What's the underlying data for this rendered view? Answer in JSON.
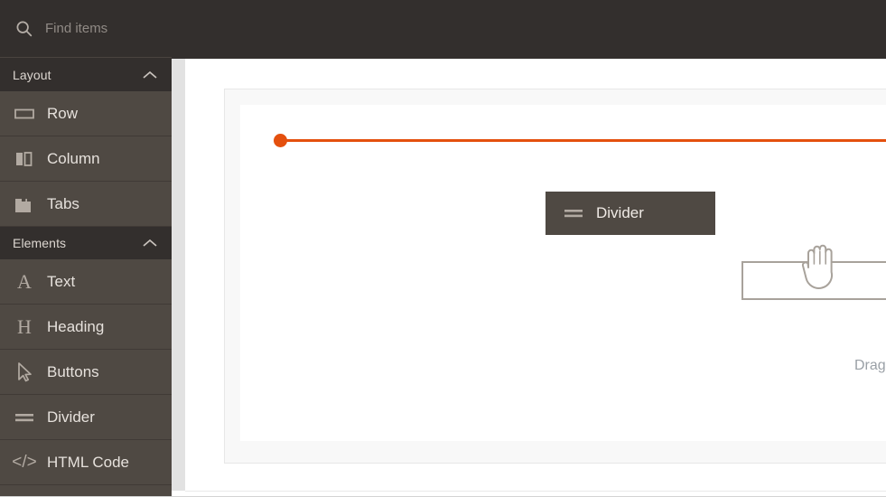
{
  "search": {
    "placeholder": "Find items",
    "value": "",
    "icon": "search-icon"
  },
  "sidebar": {
    "sections": [
      {
        "title": "Layout",
        "collapse_icon": "chevron-up-icon",
        "items": [
          {
            "label": "Row",
            "icon": "row-icon"
          },
          {
            "label": "Column",
            "icon": "column-icon"
          },
          {
            "label": "Tabs",
            "icon": "tabs-icon"
          }
        ]
      },
      {
        "title": "Elements",
        "collapse_icon": "chevron-up-icon",
        "items": [
          {
            "label": "Text",
            "icon": "text-a-icon"
          },
          {
            "label": "Heading",
            "icon": "heading-h-icon"
          },
          {
            "label": "Buttons",
            "icon": "cursor-arrow-icon"
          },
          {
            "label": "Divider",
            "icon": "divider-icon"
          },
          {
            "label": "HTML Code",
            "icon": "code-icon"
          }
        ]
      }
    ]
  },
  "canvas": {
    "drop_indicator_color": "#e4500e",
    "drag_caption": "Drag con",
    "cursor_icon": "grabbing-hand-cursor"
  },
  "drag_ghost": {
    "label": "Divider",
    "icon": "divider-icon",
    "background": "#4f4943"
  }
}
